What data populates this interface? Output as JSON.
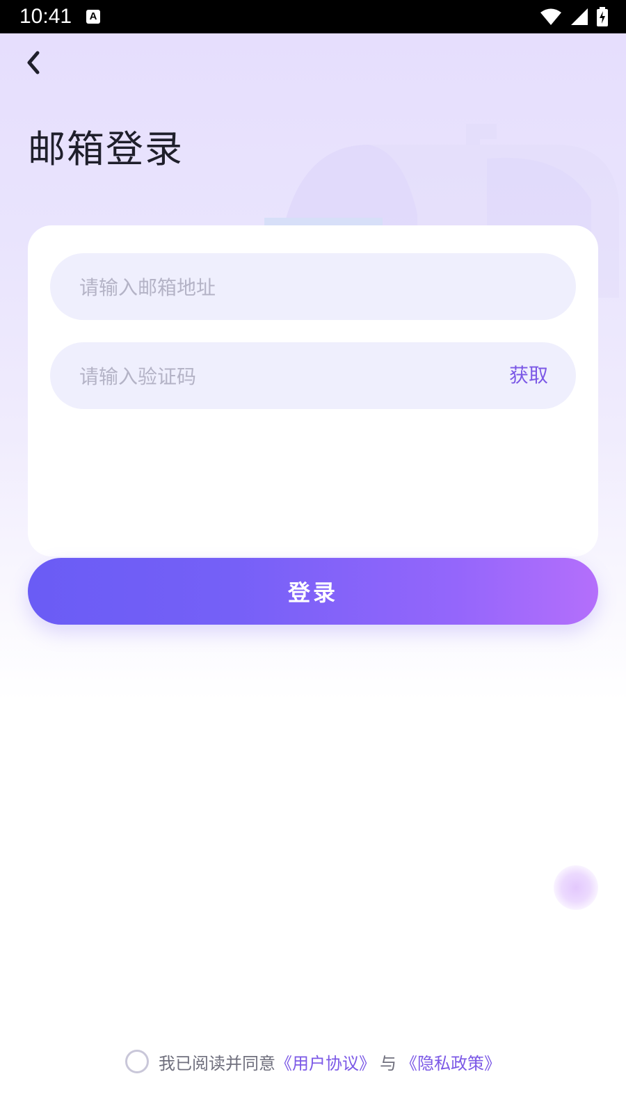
{
  "status_bar": {
    "time": "10:41",
    "notification_label": "A"
  },
  "page": {
    "title": "邮箱登录"
  },
  "form": {
    "email_placeholder": "请输入邮箱地址",
    "code_placeholder": "请输入验证码",
    "get_code_label": "获取",
    "login_label": "登录"
  },
  "agreement": {
    "prefix": "我已阅读并同意",
    "user_agreement": "《用户协议》",
    "conjunction": "与",
    "privacy_policy": "《隐私政策》",
    "checked": false
  },
  "colors": {
    "accent": "#7b58e6",
    "button_start": "#6a5cf5",
    "button_end": "#b46ffb",
    "field_bg": "#efeffd",
    "hero_bg": "#e6defd"
  },
  "icons": {
    "back": "chevron-left-icon",
    "wifi": "wifi-icon",
    "signal": "signal-icon",
    "battery": "battery-charging-icon"
  }
}
